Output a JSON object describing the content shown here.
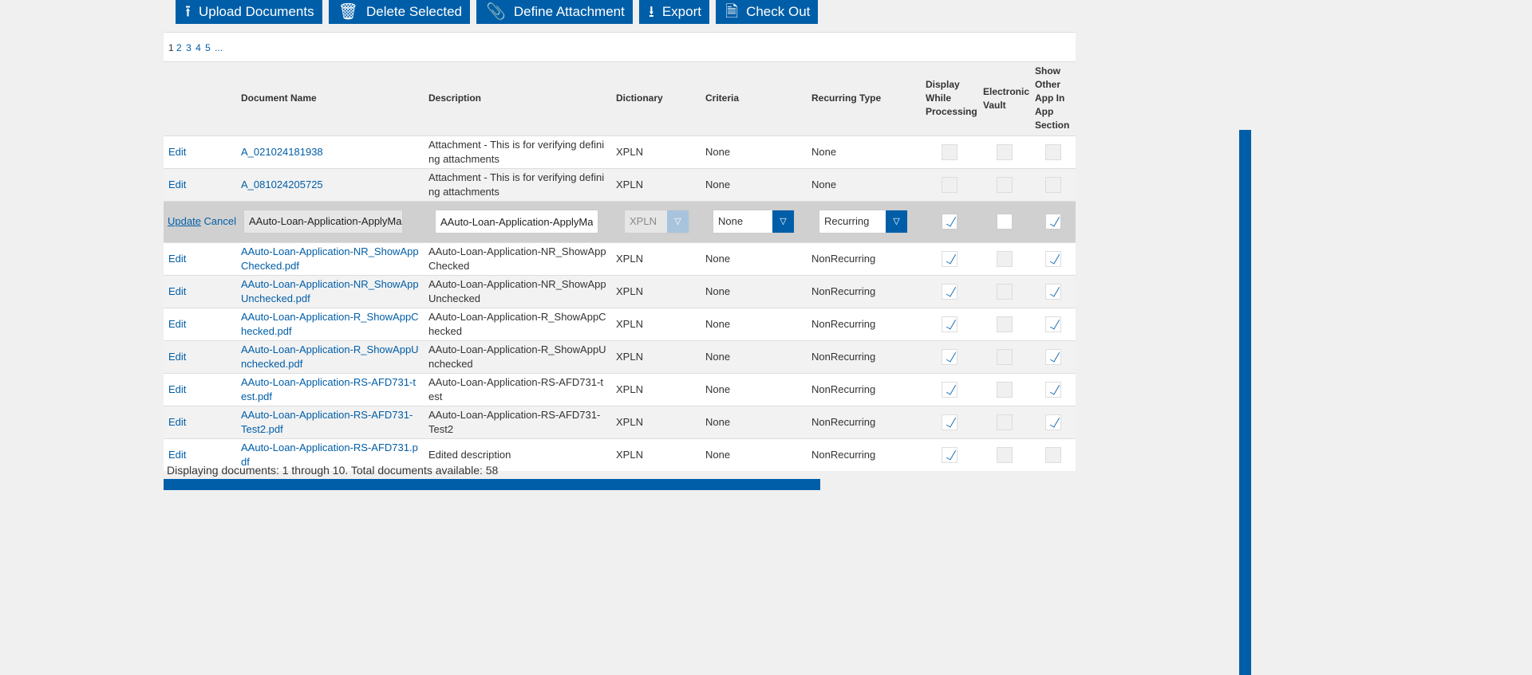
{
  "toolbar": [
    {
      "label": "Upload Documents",
      "icon": "upload-icon",
      "glyph": "⭱"
    },
    {
      "label": "Delete Selected",
      "icon": "trash-icon",
      "glyph": "🗑"
    },
    {
      "label": "Define Attachment",
      "icon": "paperclip-icon",
      "glyph": "📎"
    },
    {
      "label": "Export",
      "icon": "download-icon",
      "glyph": "⭳"
    },
    {
      "label": "Check Out",
      "icon": "checkout-icon",
      "glyph": "🗎"
    }
  ],
  "pager": {
    "current": "1",
    "pages": [
      "2",
      "3",
      "4",
      "5",
      "..."
    ]
  },
  "columns": [
    "",
    "Document Name",
    "Description",
    "Dictionary",
    "Criteria",
    "Recurring Type",
    "Display While Processing",
    "Electronic Vault",
    "Show Other App In App Section"
  ],
  "edit_row": {
    "update": "Update",
    "cancel": "Cancel",
    "name": "AAuto-Loan-Application-ApplyMark",
    "description": "AAuto-Loan-Application-ApplyMark",
    "dictionary": "XPLN",
    "criteria": "None",
    "recurring": "Recurring",
    "display": true,
    "vault": false,
    "show": true
  },
  "rows": [
    {
      "action": "Edit",
      "name": "A_021024181938",
      "description": "Attachment - This is for verifying defining attachments",
      "dictionary": "XPLN",
      "criteria": "None",
      "recurring": "None",
      "display": false,
      "vault": false,
      "show": false
    },
    {
      "action": "Edit",
      "name": "A_081024205725",
      "description": "Attachment - This is for verifying defining attachments",
      "dictionary": "XPLN",
      "criteria": "None",
      "recurring": "None",
      "display": false,
      "vault": false,
      "show": false
    },
    {
      "action": "Edit",
      "name": "AAuto-Loan-Application-NR_ShowAppChecked.pdf",
      "description": "AAuto-Loan-Application-NR_ShowAppChecked",
      "dictionary": "XPLN",
      "criteria": "None",
      "recurring": "NonRecurring",
      "display": true,
      "vault": false,
      "show": true
    },
    {
      "action": "Edit",
      "name": "AAuto-Loan-Application-NR_ShowAppUnchecked.pdf",
      "description": "AAuto-Loan-Application-NR_ShowAppUnchecked",
      "dictionary": "XPLN",
      "criteria": "None",
      "recurring": "NonRecurring",
      "display": true,
      "vault": false,
      "show": true
    },
    {
      "action": "Edit",
      "name": "AAuto-Loan-Application-R_ShowAppChecked.pdf",
      "description": "AAuto-Loan-Application-R_ShowAppChecked",
      "dictionary": "XPLN",
      "criteria": "None",
      "recurring": "NonRecurring",
      "display": true,
      "vault": false,
      "show": true
    },
    {
      "action": "Edit",
      "name": "AAuto-Loan-Application-R_ShowAppUnchecked.pdf",
      "description": "AAuto-Loan-Application-R_ShowAppUnchecked",
      "dictionary": "XPLN",
      "criteria": "None",
      "recurring": "NonRecurring",
      "display": true,
      "vault": false,
      "show": true
    },
    {
      "action": "Edit",
      "name": "AAuto-Loan-Application-RS-AFD731-test.pdf",
      "description": "AAuto-Loan-Application-RS-AFD731-test",
      "dictionary": "XPLN",
      "criteria": "None",
      "recurring": "NonRecurring",
      "display": true,
      "vault": false,
      "show": true
    },
    {
      "action": "Edit",
      "name": "AAuto-Loan-Application-RS-AFD731-Test2.pdf",
      "description": "AAuto-Loan-Application-RS-AFD731-Test2",
      "dictionary": "XPLN",
      "criteria": "None",
      "recurring": "NonRecurring",
      "display": true,
      "vault": false,
      "show": true
    },
    {
      "action": "Edit",
      "name": "AAuto-Loan-Application-RS-AFD731.pdf",
      "description": "Edited description",
      "dictionary": "XPLN",
      "criteria": "None",
      "recurring": "NonRecurring",
      "display": true,
      "vault": false,
      "show": false
    }
  ],
  "status": "Displaying documents: 1 through 10. Total documents available: 58",
  "colors": {
    "accent": "#005ea8",
    "background": "#f0f0f0",
    "edit_row": "#d0d0d0"
  }
}
